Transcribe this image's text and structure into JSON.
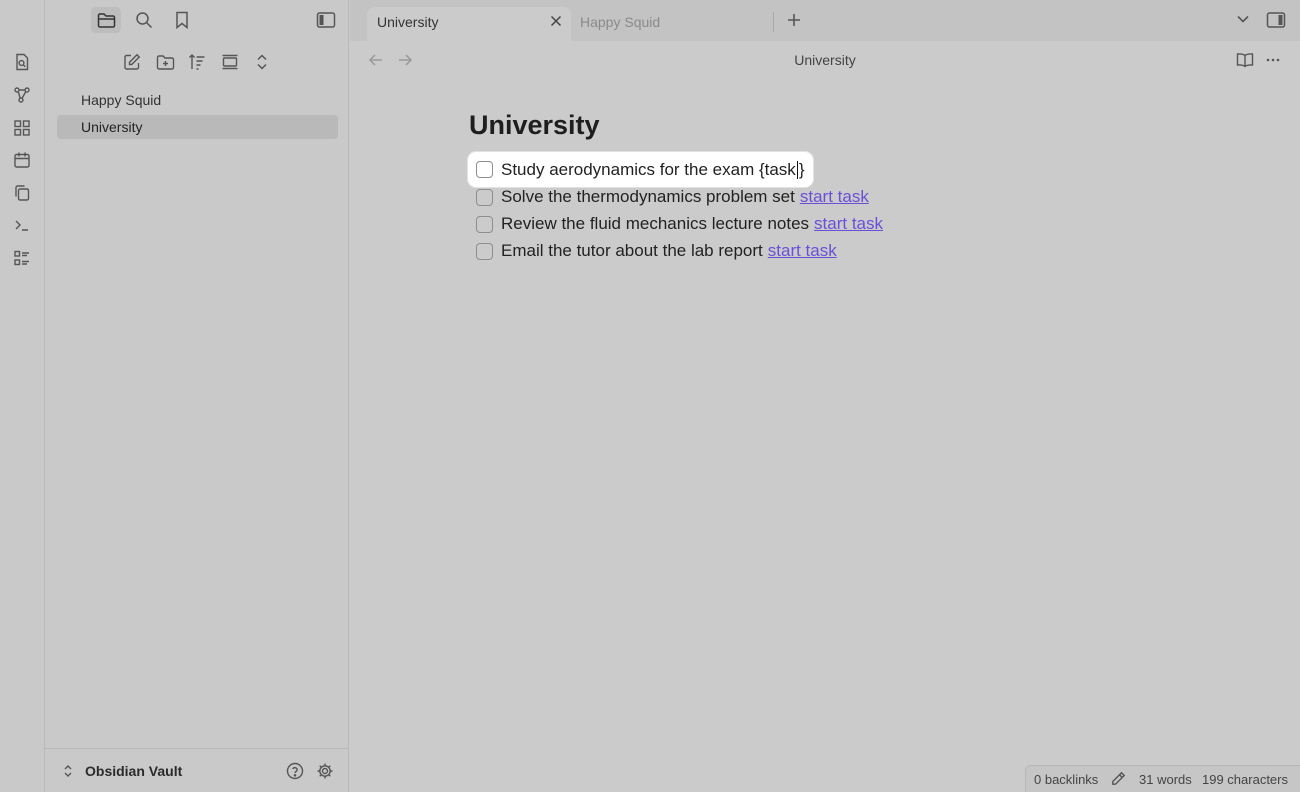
{
  "ribbon": {
    "items": [
      {
        "name": "open-quick-switcher",
        "icon": "file-search-icon"
      },
      {
        "name": "open-graph-view",
        "icon": "graph-icon"
      },
      {
        "name": "open-canvas",
        "icon": "layout-dashboard-icon"
      },
      {
        "name": "open-daily-note",
        "icon": "calendar-icon"
      },
      {
        "name": "templates",
        "icon": "copy-icon"
      },
      {
        "name": "command-palette",
        "icon": "terminal-icon"
      },
      {
        "name": "properties",
        "icon": "list-icon"
      }
    ]
  },
  "sidebar": {
    "files": [
      {
        "label": "Happy Squid",
        "active": false
      },
      {
        "label": "University",
        "active": true
      }
    ],
    "vault_name": "Obsidian Vault"
  },
  "tabs": [
    {
      "label": "University",
      "active": true
    },
    {
      "label": "Happy Squid",
      "active": false
    }
  ],
  "view": {
    "title": "University"
  },
  "note": {
    "title": "University",
    "tasks": [
      {
        "text": "Study aerodynamics for the exam {task",
        "suffix": "}",
        "focused": true
      },
      {
        "text": "Solve the thermodynamics problem set",
        "link": "start task"
      },
      {
        "text": "Review the fluid mechanics lecture notes",
        "link": "start task"
      },
      {
        "text": "Email the tutor about the lab report",
        "link": "start task"
      }
    ]
  },
  "status": {
    "backlinks": "0 backlinks",
    "words": "31 words",
    "characters": "199 characters"
  },
  "colors": {
    "link": "#6b4fd8",
    "background": "#cbcbcb",
    "focus_box": "#ffffff"
  }
}
